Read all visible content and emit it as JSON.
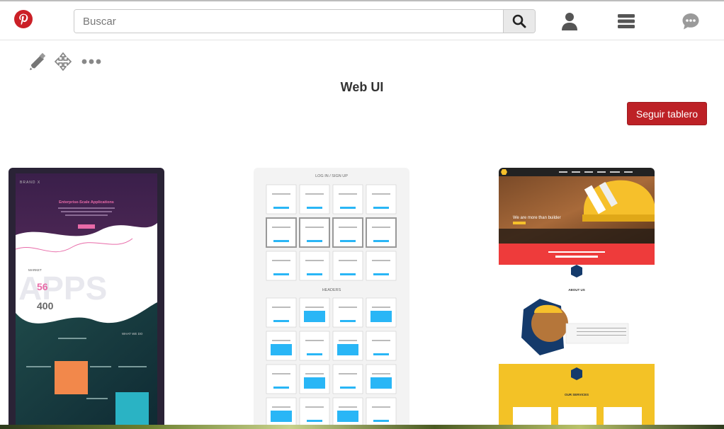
{
  "header": {
    "logo_icon": "pinterest-logo",
    "search": {
      "placeholder": "Buscar",
      "value": ""
    },
    "icons": [
      "search-icon",
      "user-icon",
      "menu-icon",
      "chat-icon"
    ]
  },
  "board": {
    "title": "Web UI",
    "follow_label": "Seguir tablero",
    "tools": [
      "pencil-icon",
      "move-icon",
      "more-icon"
    ]
  },
  "pins": [
    {
      "name": "apps-landing-pin",
      "text": {
        "brand": "BRAND X",
        "headline": "Enterprise-Scale Applications",
        "stat1": "56",
        "stat2": "400",
        "word": "APPS",
        "section": "WHAT WE DO",
        "market": "MARKET"
      }
    },
    {
      "name": "wireframe-pin",
      "text": {
        "heading1": "LOG IN / SIGN UP",
        "heading2": "HEADERS"
      }
    },
    {
      "name": "construction-pin",
      "text": {
        "headline": "We are more than builder",
        "about": "ABOUT US",
        "services": "OUR SERVICES"
      }
    }
  ],
  "colors": {
    "accent": "#bd2126",
    "logo": "#cb2027",
    "wire_blue": "#29b6f6"
  }
}
